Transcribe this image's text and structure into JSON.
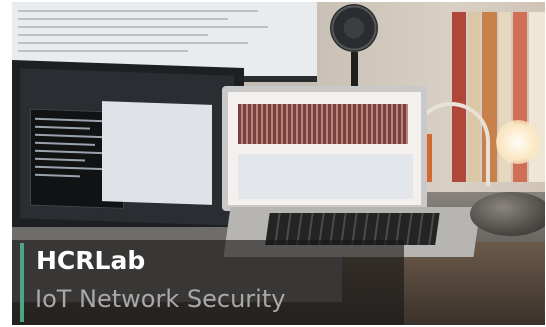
{
  "caption": {
    "title": "HCRLab",
    "subtitle": "IoT Network Security",
    "accent_color": "#4aa58d",
    "title_color": "#ffffff",
    "subtitle_color": "#a9a9a9"
  }
}
